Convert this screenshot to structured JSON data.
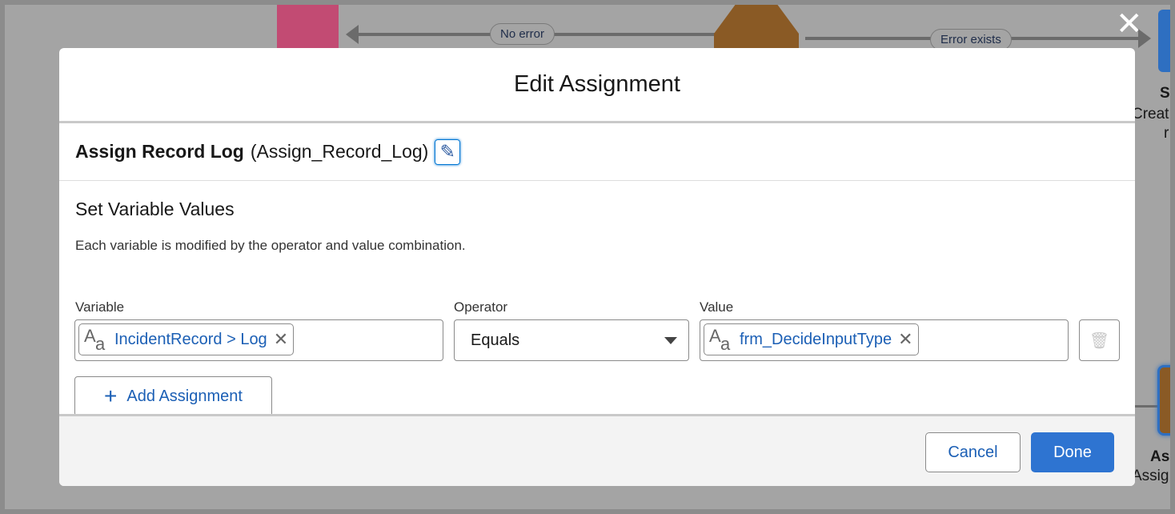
{
  "background": {
    "connector_no_error": "No error",
    "connector_error_exists": "Error exists",
    "right_node_top_title": "S",
    "right_node_top_sub": "Creat",
    "right_node_top_sub2": "r",
    "right_node_bottom_title": "As",
    "right_node_bottom_sub": "Assig"
  },
  "modal": {
    "title": "Edit Assignment",
    "element_label": "Assign Record Log",
    "element_api_name": "(Assign_Record_Log)",
    "section_title": "Set Variable Values",
    "description": "Each variable is modified by the operator and value combination.",
    "columns": {
      "variable": "Variable",
      "operator": "Operator",
      "value": "Value"
    },
    "row": {
      "variable": "IncidentRecord > Log",
      "operator": "Equals",
      "value": "frm_DecideInputType"
    },
    "add_assignment": "Add Assignment",
    "cancel": "Cancel",
    "done": "Done"
  },
  "colors": {
    "accent": "#0176d3",
    "link": "#1b5fb5"
  }
}
